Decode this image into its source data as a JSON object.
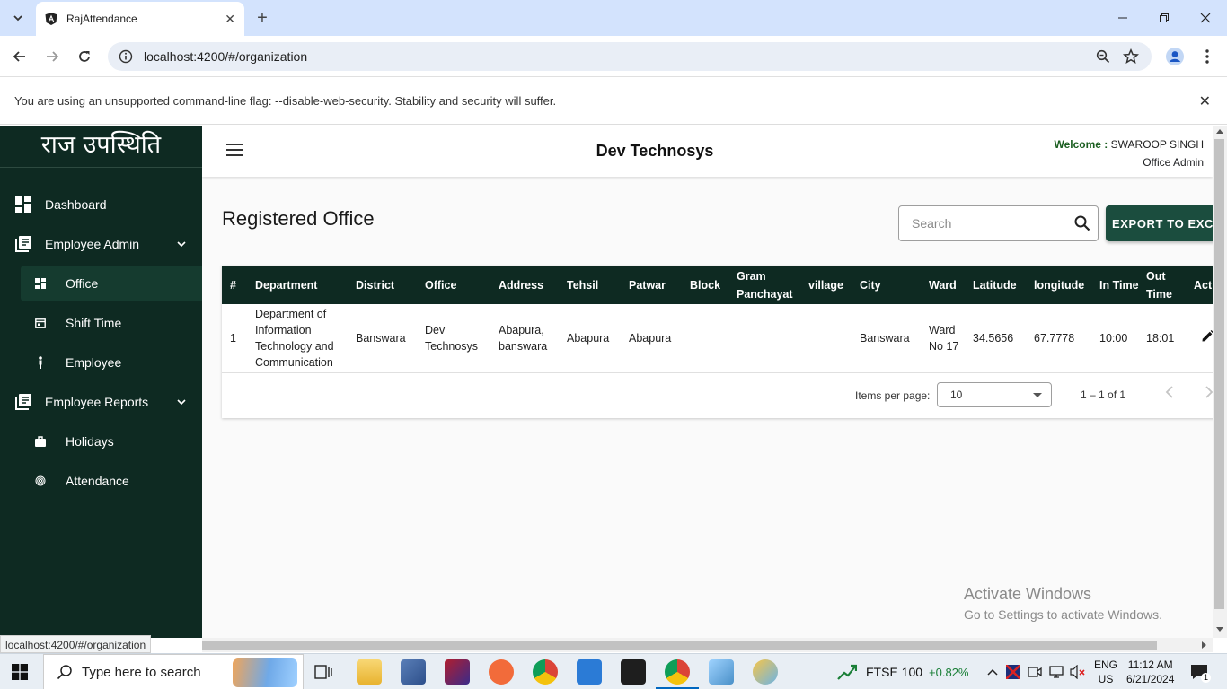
{
  "browser": {
    "tab_title": "RajAttendance",
    "url": "localhost:4200/#/organization",
    "infobar_message": "You are using an unsupported command-line flag: --disable-web-security. Stability and security will suffer.",
    "status_url": "localhost:4200/#/organization"
  },
  "sidebar": {
    "logo": "राज उपस्थिति",
    "items": [
      {
        "label": "Dashboard"
      },
      {
        "label": "Employee Admin"
      },
      {
        "label": "Office"
      },
      {
        "label": "Shift Time"
      },
      {
        "label": "Employee"
      },
      {
        "label": "Employee Reports"
      },
      {
        "label": "Holidays"
      },
      {
        "label": "Attendance"
      }
    ]
  },
  "header": {
    "brand": "Dev Technosys",
    "welcome_label": "Welcome : ",
    "user_name": "SWAROOP SINGH",
    "role": "Office Admin"
  },
  "page": {
    "title": "Registered Office",
    "search_placeholder": "Search",
    "export_label": "EXPORT TO EXCEL"
  },
  "table": {
    "columns": [
      "#",
      "Department",
      "District",
      "Office",
      "Address",
      "Tehsil",
      "Patwar",
      "Block",
      "Gram Panchayat",
      "village",
      "City",
      "Ward",
      "Latitude",
      "longitude",
      "In Time",
      "Out Time",
      "Action"
    ],
    "rows": [
      {
        "num": "1",
        "department": "Department of Information Technology and Communication",
        "district": "Banswara",
        "office": "Dev Technosys",
        "address": "Abapura, banswara",
        "tehsil": "Abapura",
        "patwar": "Abapura",
        "block": "",
        "gram_panchayat": "",
        "village": "",
        "city": "Banswara",
        "ward": "Ward No 17",
        "latitude": "34.5656",
        "longitude": "67.7778",
        "in_time": "10:00",
        "out_time": "18:01"
      }
    ]
  },
  "paginator": {
    "items_per_page_label": "Items per page:",
    "items_per_page_value": "10",
    "range": "1 – 1 of 1"
  },
  "watermark": {
    "line1": "Activate Windows",
    "line2": "Go to Settings to activate Windows."
  },
  "taskbar": {
    "search_placeholder": "Type here to search",
    "stock_name": "FTSE 100",
    "stock_change": "+0.82%",
    "lang1": "ENG",
    "lang2": "US",
    "time": "11:12 AM",
    "date": "6/21/2024",
    "notif_count": "1"
  },
  "colors": {
    "sidebar_bg": "#0e2a22",
    "accent": "#1b4d3e",
    "tabbar_bg": "#d3e3fd",
    "stock_up": "#1a7f37"
  }
}
